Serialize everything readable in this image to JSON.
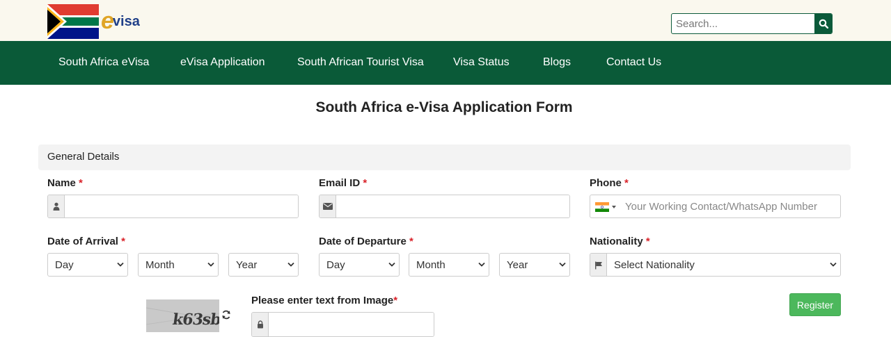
{
  "header": {
    "logo_text_e": "e",
    "logo_text_visa": "visa",
    "search_placeholder": "Search..."
  },
  "nav": {
    "items": [
      {
        "label": "South Africa eVisa"
      },
      {
        "label": "eVisa Application"
      },
      {
        "label": "South African Tourist Visa"
      },
      {
        "label": "Visa Status"
      },
      {
        "label": "Blogs"
      },
      {
        "label": "Contact Us"
      }
    ]
  },
  "page": {
    "title": "South Africa e-Visa Application Form",
    "section_title": "General Details"
  },
  "form": {
    "required_mark": "*",
    "name_label": "Name",
    "email_label": "Email ID",
    "phone_label": "Phone",
    "phone_placeholder": "Your Working Contact/WhatsApp Number",
    "arrival_label": "Date of Arrival",
    "departure_label": "Date of Departure",
    "nationality_label": "Nationality",
    "day": "Day",
    "month": "Month",
    "year": "Year",
    "nationality_value": "Select Nationality",
    "captcha_label": "Please enter text from Image",
    "captcha_text": "k63sb",
    "register_label": "Register"
  },
  "colors": {
    "nav_bg": "#0a5a38",
    "register_bg": "#4cb85c",
    "required": "#d9232a"
  }
}
